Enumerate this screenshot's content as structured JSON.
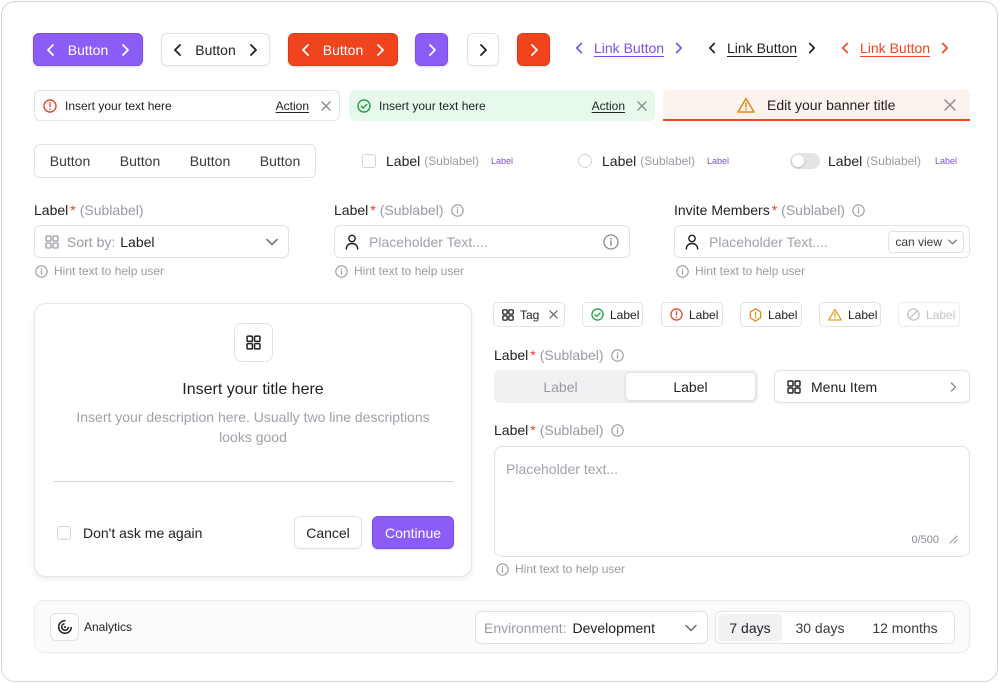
{
  "buttons": {
    "b1": "Button",
    "b2": "Button",
    "b3": "Button",
    "links": [
      "Link Button",
      "Link Button",
      "Link Button"
    ]
  },
  "alerts": {
    "error": {
      "text": "Insert your text here",
      "action": "Action"
    },
    "success": {
      "text": "Insert your text here",
      "action": "Action"
    },
    "banner": {
      "title": "Edit your banner title"
    }
  },
  "button_group": [
    "Button",
    "Button",
    "Button",
    "Button"
  ],
  "choices": {
    "checkbox": {
      "label": "Label",
      "sublabel": "(Sublabel)",
      "badge": "Label"
    },
    "radio": {
      "label": "Label",
      "sublabel": "(Sublabel)",
      "badge": "Label"
    },
    "toggle": {
      "label": "Label",
      "sublabel": "(Sublabel)",
      "badge": "Label"
    }
  },
  "fields": {
    "sort": {
      "label": "Label",
      "required": "*",
      "sublabel": "(Sublabel)",
      "prefix": "Sort by:",
      "value": "Label",
      "hint": "Hint text to help user"
    },
    "text": {
      "label": "Label",
      "required": "*",
      "sublabel": "(Sublabel)",
      "placeholder": "Placeholder Text....",
      "hint": "Hint text to help user"
    },
    "invite": {
      "label": "Invite Members",
      "required": "*",
      "sublabel": "(Sublabel)",
      "placeholder": "Placeholder Text....",
      "permission": "can view",
      "hint": "Hint text to help user"
    }
  },
  "modal": {
    "title": "Insert your title here",
    "description": "Insert your description here. Usually two line descriptions looks good",
    "checkbox_label": "Don't ask me again",
    "cancel": "Cancel",
    "continue": "Continue"
  },
  "tags": [
    "Tag",
    "Label",
    "Label",
    "Label",
    "Label",
    "Label"
  ],
  "segment_field": {
    "label": "Label",
    "required": "*",
    "sublabel": "(Sublabel)",
    "options": [
      "Label",
      "Label"
    ],
    "selected_index": 1
  },
  "menu_item": "Menu Item",
  "textarea": {
    "label": "Label",
    "required": "*",
    "sublabel": "(Sublabel)",
    "placeholder": "Placeholder text...",
    "counter": "0/500",
    "hint": "Hint text to help user"
  },
  "footer": {
    "app": "Analytics",
    "env_prefix": "Environment:",
    "env_value": "Development",
    "ranges": [
      "7 days",
      "30 days",
      "12 months"
    ],
    "selected_range": "7 days"
  },
  "colors": {
    "accent": "#8b5cf6",
    "danger": "#f0441e",
    "success_bg": "#e7f9ea",
    "warning_bg": "#fdf3ee"
  }
}
